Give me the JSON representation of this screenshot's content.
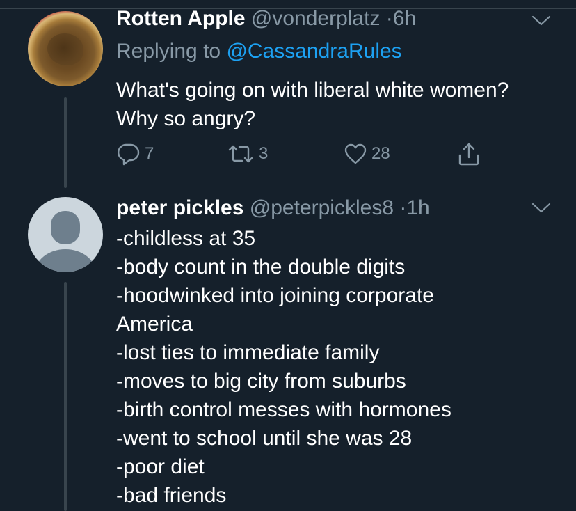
{
  "tweets": [
    {
      "name": "Rotten Apple",
      "handle": "@vonderplatz",
      "separator": "·",
      "time": "6h",
      "replying_prefix": "Replying to",
      "replying_to": "@CassandraRules",
      "text_lines": [
        "What's going on with liberal white women?",
        "Why so angry?"
      ],
      "actions": {
        "replies": "7",
        "retweets": "3",
        "likes": "28"
      },
      "avatar_icon": "rotten-apple-avatar",
      "menu_icon": "chevron-down-icon"
    },
    {
      "name": "peter pickles",
      "handle": "@peterpickles8",
      "separator": "·",
      "time": "1h",
      "text_lines": [
        "-childless at 35",
        "-body count in the double digits",
        "-hoodwinked into joining corporate",
        "America",
        "-lost ties to immediate family",
        "-moves to big city from suburbs",
        "-birth control messes with hormones",
        "-went to school until she was 28",
        "-poor diet",
        "-bad friends"
      ],
      "avatar_icon": "default-profile-avatar",
      "menu_icon": "chevron-down-icon"
    }
  ],
  "colors": {
    "background": "#15202b",
    "text": "#ffffff",
    "secondary": "#8899a6",
    "link": "#1da1f2",
    "thread_line": "#38444d"
  }
}
